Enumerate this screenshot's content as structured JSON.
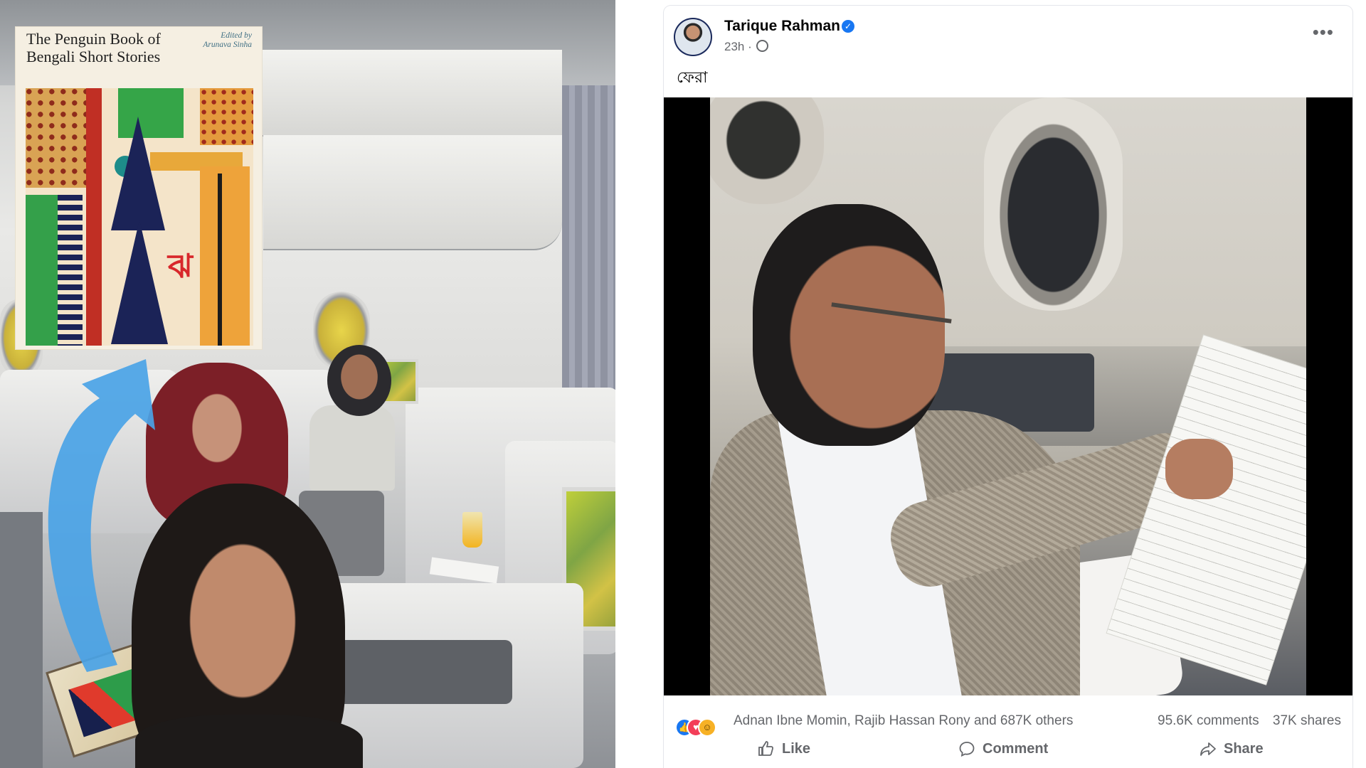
{
  "book": {
    "title_line1": "The Penguin Book of",
    "title_line2": "Bengali Short Stories",
    "editor_line1": "Edited by",
    "editor_line2": "Arunava Sinha"
  },
  "post": {
    "author": "Tarique Rahman",
    "timestamp": "23h ·",
    "text": "ফেরা",
    "reaction_names": "Adnan Ibne Momin, Rajib Hassan Rony and 687K others",
    "comments": "95.6K comments",
    "shares": "37K shares",
    "actions": {
      "like": "Like",
      "comment": "Comment",
      "share": "Share"
    },
    "icons": {
      "verified": "verified-badge-icon",
      "privacy": "globe-icon",
      "more": "more-options-icon"
    }
  },
  "colors": {
    "facebook_blue": "#1877f2",
    "secondary_text": "#65676b",
    "arrow": "#4aa3e6"
  }
}
